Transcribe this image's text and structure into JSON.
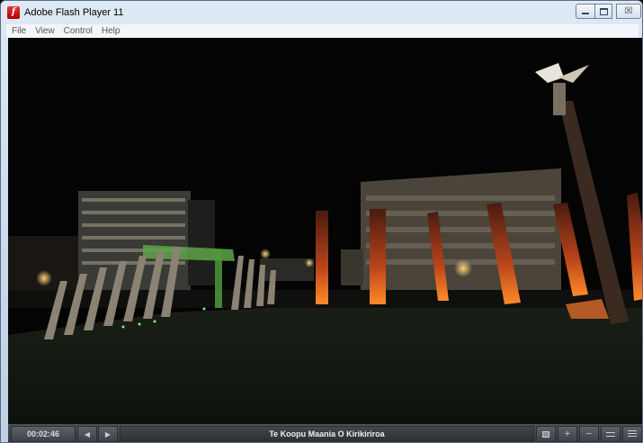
{
  "window": {
    "title": "Adobe Flash Player 11",
    "app_icon": "f",
    "icons": {
      "app": "flash-player-icon",
      "minimize": "minimize-icon",
      "maximize": "maximize-icon",
      "close": "close-icon"
    },
    "close_glyph": "☒"
  },
  "menubar": {
    "items": [
      "File",
      "View",
      "Control",
      "Help"
    ]
  },
  "player": {
    "time": "00:02:46",
    "caption": "Te Koopu Maania O Kirikiriroa",
    "prev_glyph": "◀",
    "next_glyph": "▶",
    "plus_glyph": "+",
    "minus_glyph": "−",
    "icons": [
      "prev-icon",
      "next-icon",
      "fit-view-icon",
      "zoom-in-icon",
      "zoom-out-icon",
      "window-mode-icon",
      "menu-icon"
    ]
  }
}
